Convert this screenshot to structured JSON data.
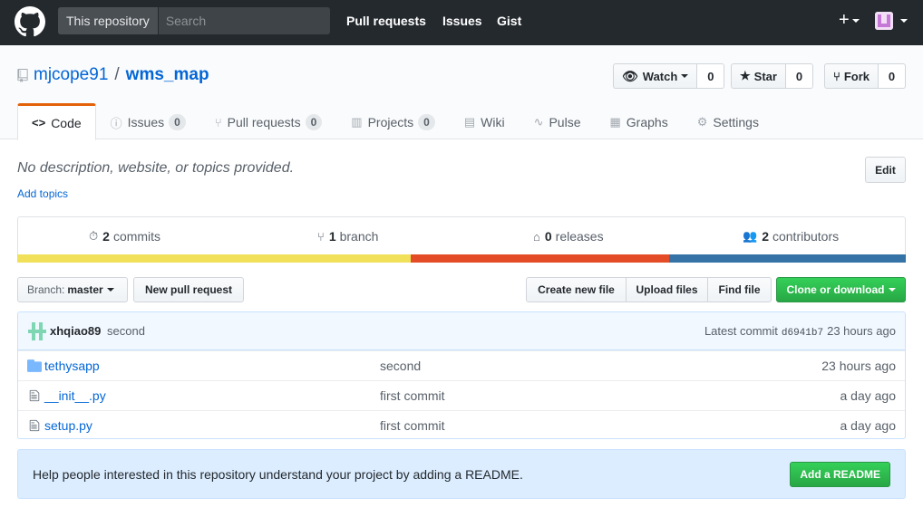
{
  "header": {
    "scope_label": "This repository",
    "search_placeholder": "Search",
    "nav": [
      "Pull requests",
      "Issues",
      "Gist"
    ],
    "plus": "+"
  },
  "repo": {
    "owner": "mjcope91",
    "separator": "/",
    "name": "wms_map",
    "watch": {
      "label": "Watch",
      "count": "0"
    },
    "star": {
      "label": "Star",
      "count": "0"
    },
    "fork": {
      "label": "Fork",
      "count": "0"
    }
  },
  "tabs": [
    {
      "label": "Code",
      "icon": "code-icon",
      "glyph": "<>"
    },
    {
      "label": "Issues",
      "counter": "0",
      "icon": "issue-icon",
      "glyph": "ⓘ"
    },
    {
      "label": "Pull requests",
      "counter": "0",
      "icon": "pull-request-icon",
      "glyph": "⑂"
    },
    {
      "label": "Projects",
      "counter": "0",
      "icon": "project-icon",
      "glyph": "▥"
    },
    {
      "label": "Wiki",
      "icon": "book-icon",
      "glyph": "▤"
    },
    {
      "label": "Pulse",
      "icon": "pulse-icon",
      "glyph": "∿"
    },
    {
      "label": "Graphs",
      "icon": "graph-icon",
      "glyph": "▦"
    },
    {
      "label": "Settings",
      "icon": "gear-icon",
      "glyph": "⚙"
    }
  ],
  "description": {
    "text": "No description, website, or topics provided.",
    "add_topics": "Add topics",
    "edit": "Edit"
  },
  "summary": {
    "commits": {
      "count": "2",
      "label": "commits"
    },
    "branch": {
      "count": "1",
      "label": "branch"
    },
    "releases": {
      "count": "0",
      "label": "releases"
    },
    "contributors": {
      "count": "2",
      "label": "contributors"
    }
  },
  "language_colors": [
    "#f1e05a",
    "#e34c26",
    "#3572a5"
  ],
  "language_fractions": [
    0.443,
    0.291,
    0.266
  ],
  "file_nav": {
    "branch_prefix": "Branch:",
    "branch": "master",
    "new_pr": "New pull request",
    "create_file": "Create new file",
    "upload_files": "Upload files",
    "find_file": "Find file",
    "clone": "Clone or download"
  },
  "latest_commit": {
    "author": "xhqiao89",
    "message": "second",
    "prefix": "Latest commit",
    "sha": "d6941b7",
    "age": "23 hours ago"
  },
  "files": [
    {
      "name": "tethysapp",
      "type": "folder",
      "message": "second",
      "age": "23 hours ago"
    },
    {
      "name": "__init__.py",
      "type": "file",
      "message": "first commit",
      "age": "a day ago"
    },
    {
      "name": "setup.py",
      "type": "file",
      "message": "first commit",
      "age": "a day ago"
    }
  ],
  "readme_prompt": {
    "text": "Help people interested in this repository understand your project by adding a README.",
    "button": "Add a README"
  }
}
